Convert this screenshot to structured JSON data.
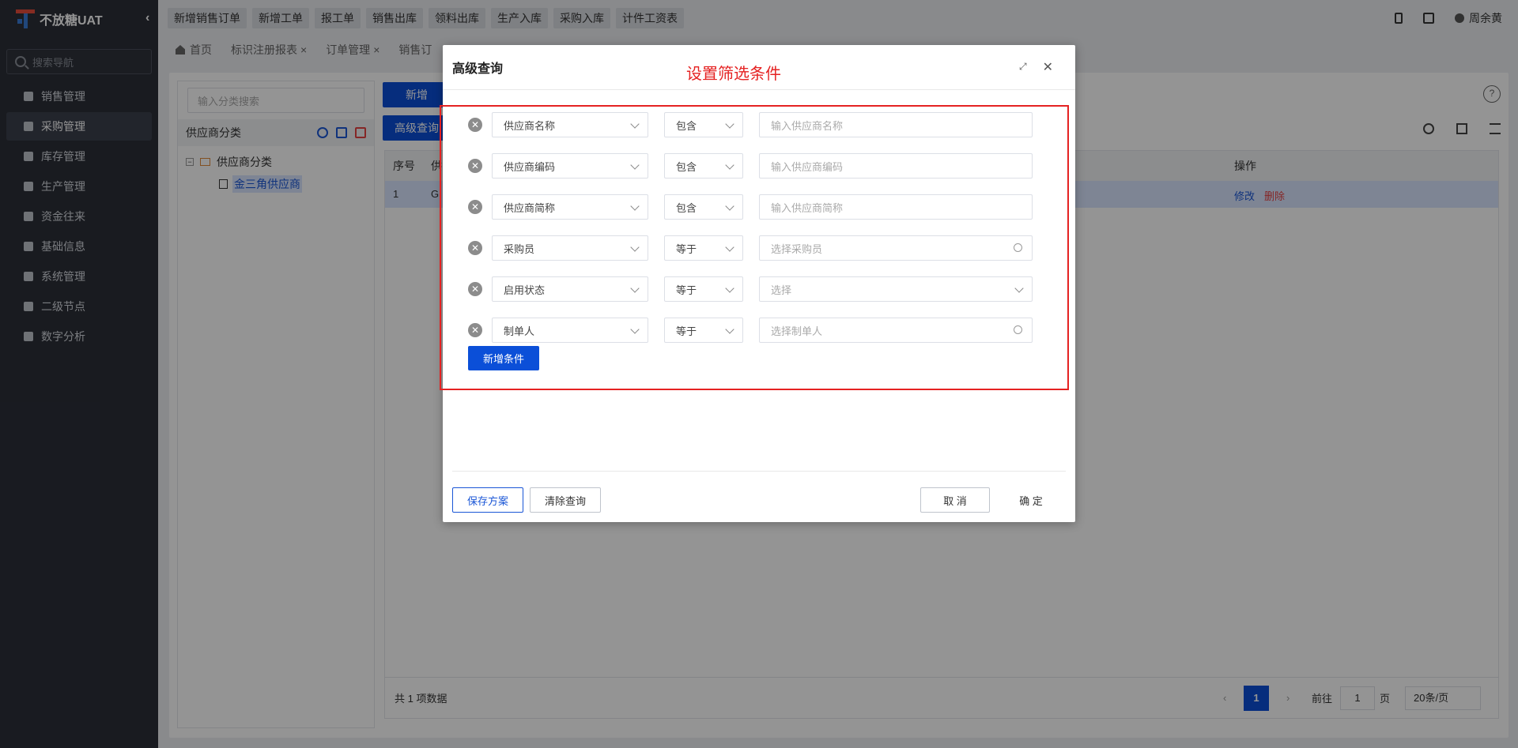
{
  "app": {
    "title": "不放糖UAT",
    "collapse_icon": "‹"
  },
  "topbar": {
    "quick": [
      "新增销售订单",
      "新增工单",
      "报工单",
      "销售出库",
      "领料出库",
      "生产入库",
      "采购入库",
      "计件工资表"
    ],
    "user": "周余黄"
  },
  "sidebar": {
    "search_placeholder": "搜索导航",
    "items": [
      "销售管理",
      "采购管理",
      "库存管理",
      "生产管理",
      "资金往来",
      "基础信息",
      "系统管理",
      "二级节点",
      "数字分析"
    ],
    "active_index": 1
  },
  "tabs": [
    "首页",
    "标识注册报表",
    "订单管理",
    "销售订"
  ],
  "left_panel": {
    "search_placeholder": "输入分类搜索",
    "title": "供应商分类",
    "tree_root": "供应商分类",
    "tree_child": "金三角供应商"
  },
  "toolbar": {
    "add": "新增",
    "advanced": "高级查询"
  },
  "table": {
    "headers": {
      "index": "序号",
      "col2": "供",
      "op": "操作"
    },
    "row": {
      "index": "1",
      "col2": "G",
      "edit": "修改",
      "delete": "删除"
    }
  },
  "pager": {
    "total": "共 1 项数据",
    "page": "1",
    "goto_prefix": "前往",
    "goto_value": "1",
    "goto_suffix": "页",
    "size": "20条/页"
  },
  "modal": {
    "title": "高级查询",
    "annotation": "设置筛选条件",
    "conditions": [
      {
        "field": "供应商名称",
        "op": "包含",
        "placeholder": "输入供应商名称",
        "kind": "text"
      },
      {
        "field": "供应商编码",
        "op": "包含",
        "placeholder": "输入供应商编码",
        "kind": "text"
      },
      {
        "field": "供应商简称",
        "op": "包含",
        "placeholder": "输入供应商简称",
        "kind": "text"
      },
      {
        "field": "采购员",
        "op": "等于",
        "placeholder": "选择采购员",
        "kind": "lookup"
      },
      {
        "field": "启用状态",
        "op": "等于",
        "placeholder": "选择",
        "kind": "select"
      },
      {
        "field": "制单人",
        "op": "等于",
        "placeholder": "选择制单人",
        "kind": "lookup"
      }
    ],
    "add_condition": "新增条件",
    "save_scheme": "保存方案",
    "clear_query": "清除查询",
    "cancel": "取 消",
    "confirm": "确 定"
  },
  "colors": {
    "primary": "#0b4fd8",
    "annotation": "#e52222",
    "sidebar": "#2b2f38"
  }
}
